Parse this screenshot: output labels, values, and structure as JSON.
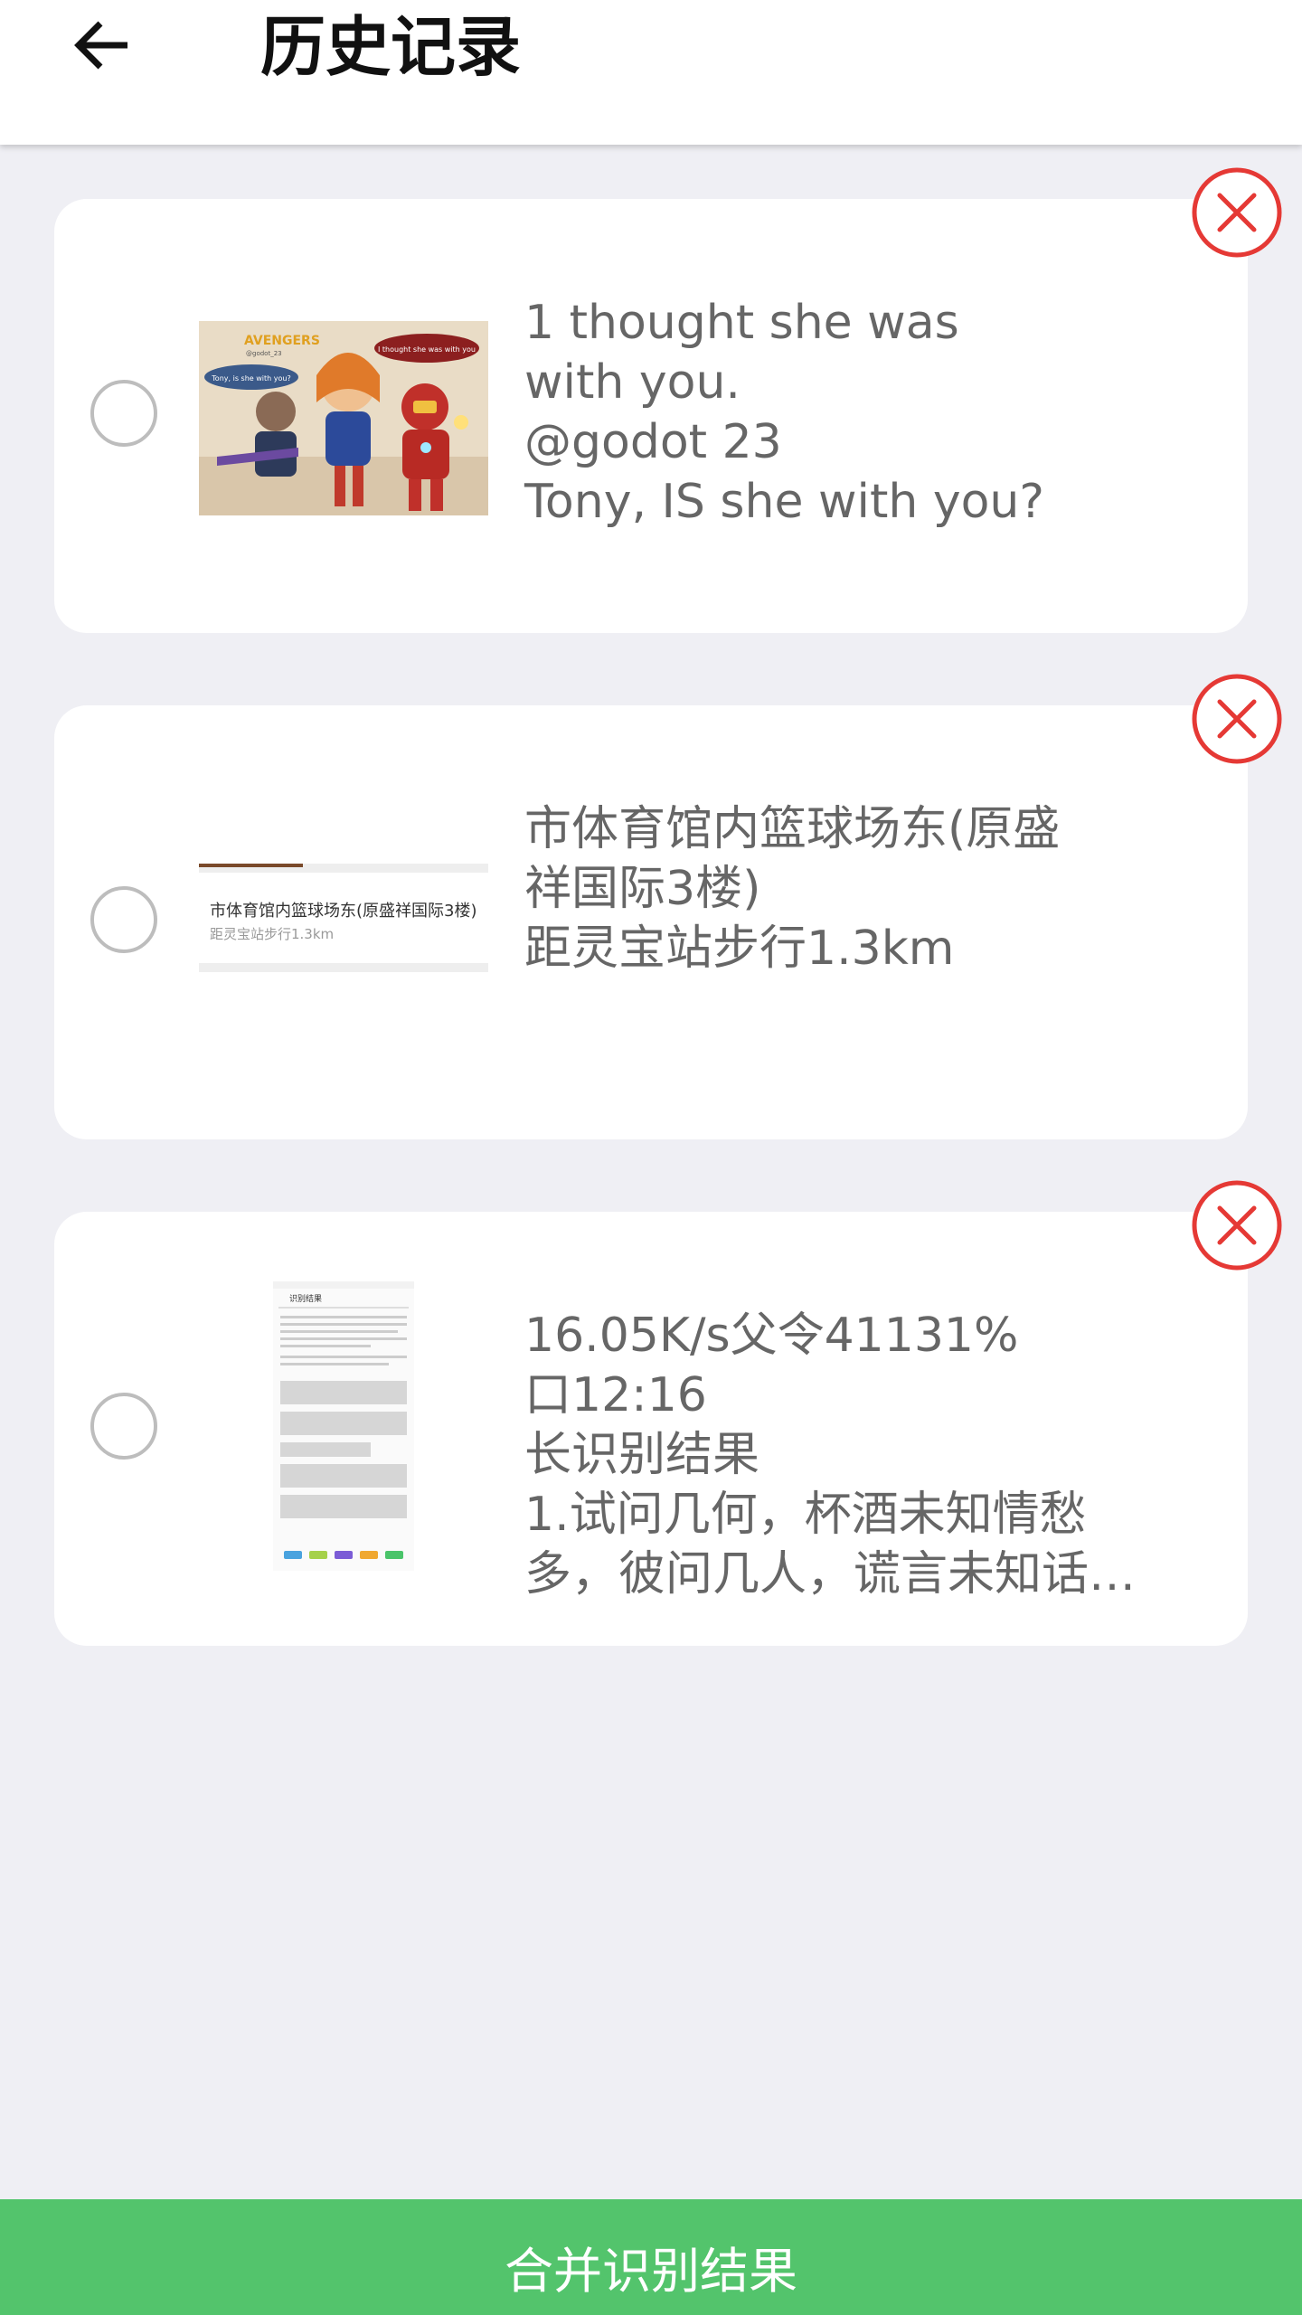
{
  "header": {
    "title": "历史记录",
    "back_icon": "arrow-left-icon"
  },
  "records": [
    {
      "text": "1 thought she was\nwith you.\n@godot 23\nTony, IS she with you?",
      "thumbnail": "avengers-cartoon-image",
      "thumb_texts": [
        "AVENGERS",
        "@godot_23",
        "Tony, is she with you?",
        "I thought she was with you"
      ]
    },
    {
      "text": "市体育馆内篮球场东(原盛\n祥国际3楼)\n距灵宝站步行1.3km",
      "thumbnail": "location-screenshot-image",
      "thumb_texts": [
        "市体育馆内篮球场东(原盛祥国际3楼)",
        "距灵宝站步行1.3km"
      ]
    },
    {
      "text": "16.05K/s父令41131%\n口12:16\n长识别结果\n1.试问几何，杯酒未知情愁\n多，彼问几人，谎言未知话…",
      "thumbnail": "phone-screenshot-image",
      "thumb_texts": [
        "识别结果"
      ]
    }
  ],
  "icons": {
    "delete": "close-circle-icon",
    "select": "radio-unchecked-icon"
  },
  "colors": {
    "accent_green": "#53c46c",
    "delete_red": "#e53935",
    "background": "#efeff4"
  },
  "footer": {
    "merge_label": "合并识别结果"
  }
}
